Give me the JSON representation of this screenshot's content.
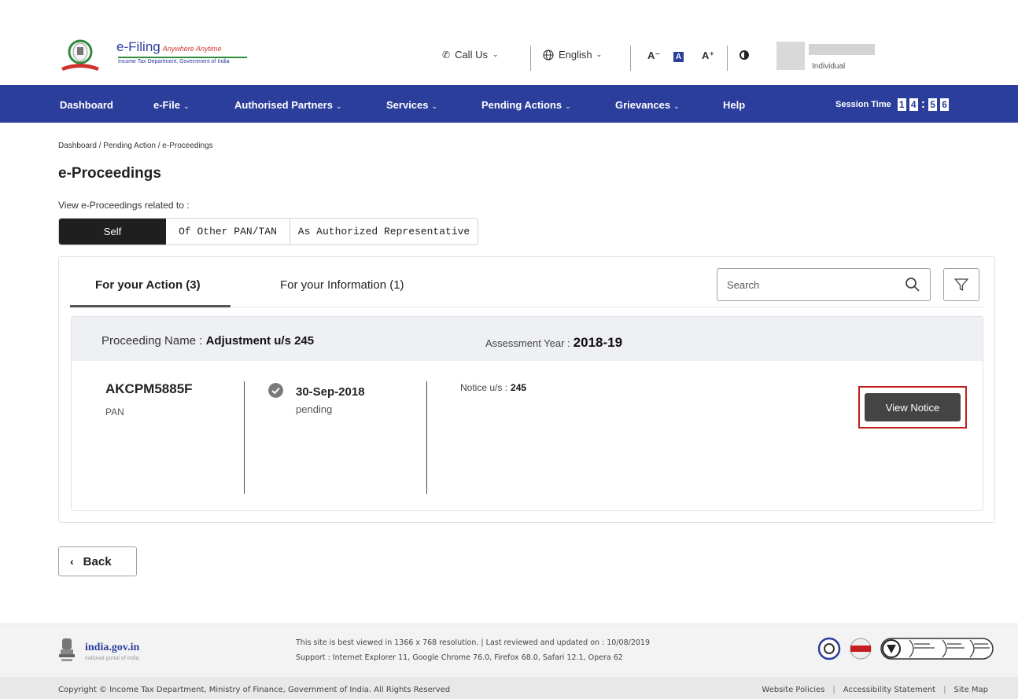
{
  "header": {
    "logo_title": "e-Filing",
    "logo_tagline": "Anywhere Anytime",
    "logo_subtitle": "Income Tax Department, Government of India",
    "call_us": "Call Us",
    "language": "English",
    "font_decrease": "A⁻",
    "font_normal": "A",
    "font_increase": "A⁺",
    "user_type": "Individual"
  },
  "nav": {
    "items": [
      "Dashboard",
      "e-File",
      "Authorised Partners",
      "Services",
      "Pending Actions",
      "Grievances",
      "Help"
    ],
    "session_label": "Session Time",
    "session_digits": [
      "1",
      "4",
      "5",
      "6"
    ]
  },
  "breadcrumb": "Dashboard / Pending Action / e-Proceedings",
  "page_title": "e-Proceedings",
  "view_label": "View e-Proceedings related to :",
  "segments": [
    "Self",
    "Of Other PAN/TAN",
    "As Authorized Representative"
  ],
  "tabs": [
    "For your Action (3)",
    "For your Information (1)"
  ],
  "search": {
    "placeholder": "Search"
  },
  "proceeding": {
    "name_label": "Proceeding Name :",
    "name_value": "Adjustment u/s 245",
    "ay_label": "Assessment Year :",
    "ay_value": "2018-19",
    "pan": "AKCPM5885F",
    "pan_label": "PAN",
    "date": "30-Sep-2018",
    "status": "pending",
    "notice_label": "Notice u/s :",
    "notice_value": "245",
    "view_button": "View Notice"
  },
  "back_button": "Back",
  "footer": {
    "gov_title": "india.gov.in",
    "gov_subtitle": "national portal of india",
    "line1": "This site is best viewed in 1366 x 768 resolution.   |   Last reviewed and updated on : 10/08/2019",
    "line2": "Support : Internet Explorer 11, Google Chrome 76.0,  Firefox 68.0, Safari 12.1, Opera 62",
    "copyright": "Copyright © Income Tax Department, Ministry of Finance, Government of India. All Rights Reserved",
    "links": [
      "Website Policies",
      "Accessibility Statement",
      "Site Map"
    ]
  },
  "colors": {
    "brand": "#2c3e9c",
    "highlight": "#c41e1e"
  }
}
